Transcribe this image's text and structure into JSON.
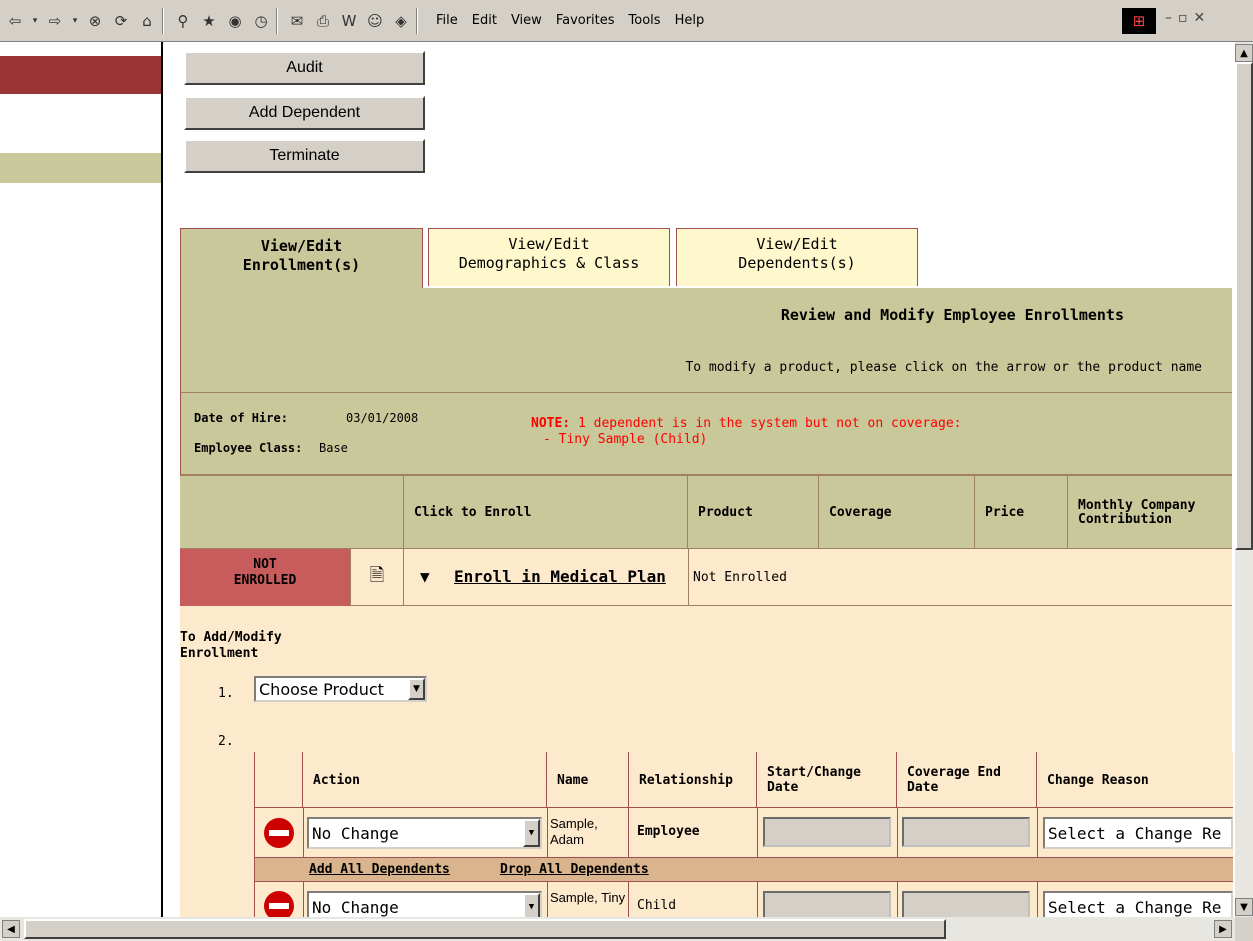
{
  "toolbar": {
    "menus": [
      "File",
      "Edit",
      "View",
      "Favorites",
      "Tools",
      "Help"
    ],
    "icons": [
      "back-icon",
      "forward-icon",
      "stop-icon",
      "refresh-icon",
      "home-icon",
      "search-icon",
      "favorites-icon",
      "history-icon",
      "mail-icon",
      "print-icon",
      "edit-icon",
      "messenger-icon",
      "related-icon"
    ]
  },
  "buttons": {
    "audit": "Audit",
    "add_dependent": "Add Dependent",
    "terminate": "Terminate"
  },
  "tabs": [
    {
      "line1": "View/Edit",
      "line2": "Enrollment(s)"
    },
    {
      "line1": "View/Edit",
      "line2": "Demographics & Class"
    },
    {
      "line1": "View/Edit",
      "line2": "Dependents(s)"
    }
  ],
  "panel": {
    "title": "Review and Modify Employee Enrollments",
    "subtitle": "To modify a product, please click on the arrow or the product name"
  },
  "info": {
    "hire_label": "Date of Hire:",
    "hire_date": "03/01/2008",
    "class_label": "Employee Class:",
    "class_value": "Base",
    "note_label": "NOTE:",
    "note_text": " 1 dependent is in the system but not on coverage:",
    "note_item": "- Tiny Sample (Child)"
  },
  "table": {
    "headers": [
      "Click to Enroll",
      "Product",
      "Coverage",
      "Price",
      "Monthly Company Contribution"
    ]
  },
  "row": {
    "status_line1": "NOT",
    "status_line2": "ENROLLED",
    "link": "Enroll in Medical Plan",
    "product": "Not Enrolled"
  },
  "modify": {
    "label_line1": "To Add/Modify",
    "label_line2": "Enrollment",
    "step1": "1.",
    "step2": "2.",
    "product_select": "Choose Product"
  },
  "grid": {
    "headers": [
      "Action",
      "Name",
      "Relationship",
      "Start/Change Date",
      "Coverage End Date",
      "Change Reason"
    ],
    "rows": [
      {
        "action": "No Change",
        "name": "Sample, Adam",
        "relationship": "Employee",
        "reason": "Select a Change Re"
      },
      {
        "action": "No Change",
        "name": "Sample, Tiny",
        "relationship": "Child",
        "reason": "Select a Change Re"
      }
    ],
    "add_all": "Add All Dependents",
    "drop_all": "Drop All Dependents"
  }
}
